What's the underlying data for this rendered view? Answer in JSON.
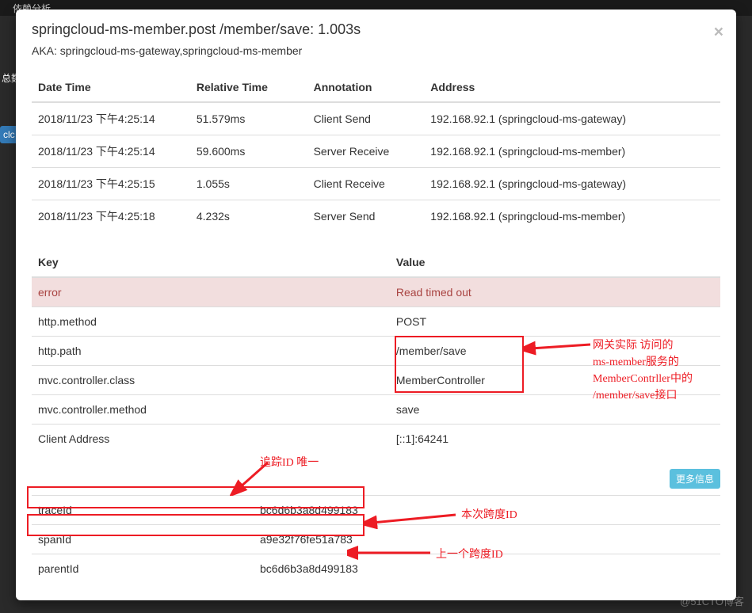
{
  "backdrop": {
    "title": "依赖分析",
    "sideText": "总数",
    "sideBtn": "clc"
  },
  "modal": {
    "title": "springcloud-ms-member.post /member/save: 1.003s",
    "aka": "AKA: springcloud-ms-gateway,springcloud-ms-member",
    "close": "×"
  },
  "table1": {
    "headers": {
      "dt": "Date Time",
      "rt": "Relative Time",
      "an": "Annotation",
      "ad": "Address"
    },
    "rows": [
      {
        "dt": "2018/11/23 下午4:25:14",
        "rt": "51.579ms",
        "an": "Client Send",
        "ad": "192.168.92.1 (springcloud-ms-gateway)"
      },
      {
        "dt": "2018/11/23 下午4:25:14",
        "rt": "59.600ms",
        "an": "Server Receive",
        "ad": "192.168.92.1 (springcloud-ms-member)"
      },
      {
        "dt": "2018/11/23 下午4:25:15",
        "rt": "1.055s",
        "an": "Client Receive",
        "ad": "192.168.92.1 (springcloud-ms-gateway)"
      },
      {
        "dt": "2018/11/23 下午4:25:18",
        "rt": "4.232s",
        "an": "Server Send",
        "ad": "192.168.92.1 (springcloud-ms-member)"
      }
    ]
  },
  "table2": {
    "headers": {
      "k": "Key",
      "v": "Value"
    },
    "rows": [
      {
        "k": "error",
        "v": "Read timed out",
        "err": true
      },
      {
        "k": "http.method",
        "v": "POST"
      },
      {
        "k": "http.path",
        "v": "/member/save"
      },
      {
        "k": "mvc.controller.class",
        "v": "MemberController"
      },
      {
        "k": "mvc.controller.method",
        "v": "save"
      },
      {
        "k": "Client Address",
        "v": "[::1]:64241"
      }
    ]
  },
  "moreInfo": "更多信息",
  "table3": {
    "rows": [
      {
        "k": "traceId",
        "v": "bc6d6b3a8d499183"
      },
      {
        "k": "spanId",
        "v": "a9e32f76fe51a783"
      },
      {
        "k": "parentId",
        "v": "bc6d6b3a8d499183"
      }
    ]
  },
  "annotations": {
    "gateway": "网关实际 访问的\nms-member服务的\nMemberContrller中的\n/member/save接口",
    "traceId": "追踪ID  唯一",
    "spanId": "本次跨度ID",
    "parentId": "上一个跨度ID"
  },
  "watermark": "@51CTO博客"
}
